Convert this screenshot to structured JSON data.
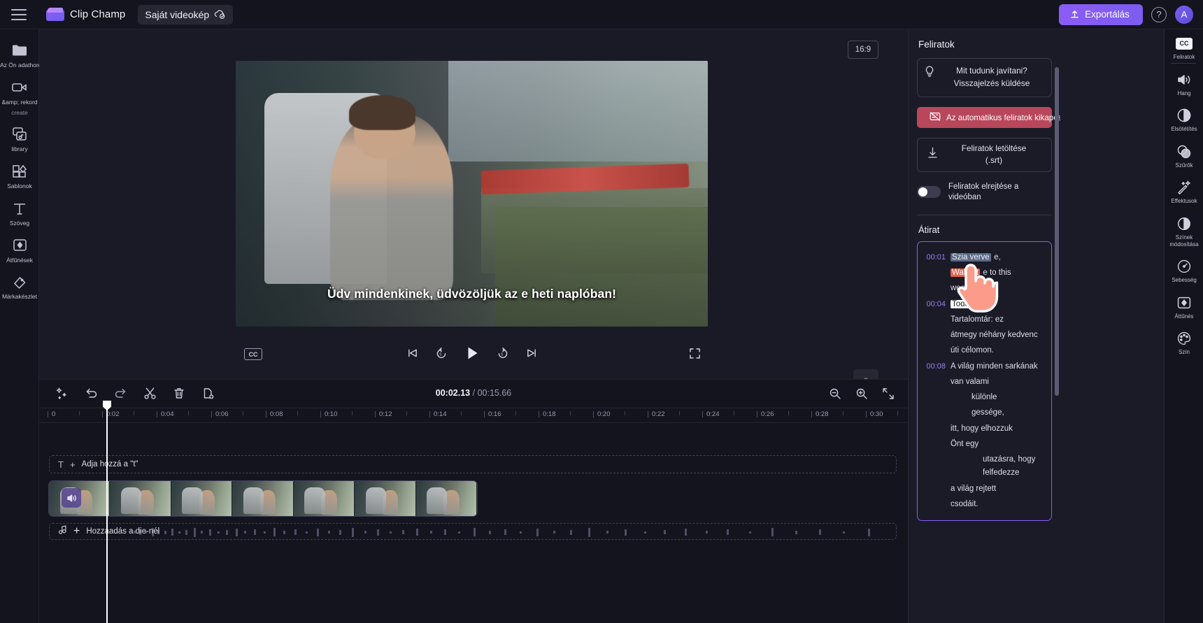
{
  "topbar": {
    "menu_icon": "hamburger-icon",
    "brand": "Clip Champ",
    "project_name": "Saját videokép",
    "project_sync_icon": "cloud-check-icon",
    "export_label": "Exportálás",
    "help_label": "?",
    "avatar_label": "A"
  },
  "left_rail": [
    {
      "icon": "folder-icon",
      "label": "Az Ön adathordozója",
      "sub": ""
    },
    {
      "icon": "video-camera-icon",
      "label": "&amp; rekord",
      "sub": "create"
    },
    {
      "icon": "library-icon",
      "label": "library",
      "sub": ""
    },
    {
      "icon": "templates-icon",
      "label": "Sablonok",
      "sub": ""
    },
    {
      "icon": "text-icon",
      "label": "Szöveg",
      "sub": ""
    },
    {
      "icon": "transitions-icon",
      "label": "Átfűnések",
      "sub": ""
    },
    {
      "icon": "brand-kit-icon",
      "label": "Márkakészlet",
      "sub": ""
    }
  ],
  "stage": {
    "aspect_ratio": "16:9",
    "caption_overlay": "Üdv mindenkinek, üdvözöljük az e heti naplóban!",
    "cc_button": "CC",
    "transport": [
      {
        "name": "skip-back-icon"
      },
      {
        "name": "rewind-5-icon"
      },
      {
        "name": "play-icon"
      },
      {
        "name": "forward-5-icon"
      },
      {
        "name": "skip-forward-icon"
      }
    ],
    "fullscreen_icon": "fullscreen-icon",
    "collapse_icon": "chevron-down-icon"
  },
  "timeline": {
    "tools": [
      {
        "name": "magic-wand-icon"
      },
      {
        "name": "undo-icon"
      },
      {
        "name": "redo-icon"
      },
      {
        "name": "split-scissors-icon"
      },
      {
        "name": "delete-trash-icon"
      },
      {
        "name": "duplicate-icon"
      }
    ],
    "current_time": "00:02.13",
    "separator": "/",
    "total_time": "00:15.66",
    "right_tools": [
      {
        "name": "zoom-out-icon"
      },
      {
        "name": "zoom-in-icon"
      },
      {
        "name": "fit-to-screen-icon"
      }
    ],
    "ruler_ticks": [
      "0",
      "0:02",
      "0:04",
      "0:06",
      "0:08",
      "0:10",
      "0:12",
      "0:14",
      "0:16",
      "0:18",
      "0:20",
      "0:22",
      "0:24",
      "0:26",
      "0:28",
      "0:30"
    ],
    "text_track_label": "Adja hozzá a \"t\"",
    "audio_track_label": "Hozzáadás a die-nél",
    "video_clip_audio_icon": "speaker-icon"
  },
  "captions_panel": {
    "title": "Feliratok",
    "feedback_line1": "Mit tudunk javítani?",
    "feedback_line2": "Visszajelzés küldése",
    "feedback_icon": "lightbulb-icon",
    "turn_off_label": "Az automatikus feliratok kikapcsolása",
    "turn_off_icon": "captions-off-icon",
    "turn_off_color": "#b8475b",
    "download_line1": "Feliratok letöltése",
    "download_line2": "(.srt)",
    "download_icon": "download-arrow-icon",
    "hide_toggle_label": "Feliratok elrejtése a videóban",
    "hide_toggle_state": "off",
    "transcript_title": "Átirat",
    "transcript_border_color": "#8b5cf6",
    "transcript": [
      {
        "time": "00:01",
        "segments": [
          {
            "text": "Szia verve",
            "style": "selected"
          },
          {
            "text": "e,",
            "style": "plain"
          }
        ],
        "indent": 0
      },
      {
        "time": "",
        "segments": [
          {
            "text": "Walcott",
            "style": "highlight"
          },
          {
            "text": "e to this",
            "style": "plain"
          }
        ],
        "indent": 0
      },
      {
        "time": "",
        "segments": [
          {
            "text": "week's",
            "style": "plain"
          }
        ],
        "indent": 0
      },
      {
        "time": "00:04",
        "segments": [
          {
            "text": "Todd",
            "style": "white"
          },
          {
            "text": ",",
            "style": "plain"
          }
        ],
        "indent": 0
      },
      {
        "time": "",
        "segments": [
          {
            "text": "Tartalomtár: ez",
            "style": "plain"
          }
        ],
        "indent": 0
      },
      {
        "time": "",
        "segments": [
          {
            "text": "átmegy néhány kedvenc",
            "style": "plain"
          }
        ],
        "indent": 0
      },
      {
        "time": "",
        "segments": [
          {
            "text": "úti célomon.",
            "style": "plain"
          }
        ],
        "indent": 0
      },
      {
        "time": "00:08",
        "segments": [
          {
            "text": "A világ minden sarkának",
            "style": "plain"
          }
        ],
        "indent": 0
      },
      {
        "time": "",
        "segments": [
          {
            "text": "van valami",
            "style": "plain"
          }
        ],
        "indent": 0
      },
      {
        "time": "",
        "segments": [
          {
            "text": "különle",
            "style": "plain"
          }
        ],
        "indent": 2
      },
      {
        "time": "",
        "segments": [
          {
            "text": "gessége,",
            "style": "plain"
          }
        ],
        "indent": 2
      },
      {
        "time": "",
        "segments": [
          {
            "text": "itt, hogy elhozzuk",
            "style": "plain"
          }
        ],
        "indent": 0
      },
      {
        "time": "",
        "segments": [
          {
            "text": "Önt egy",
            "style": "plain"
          }
        ],
        "indent": 0
      },
      {
        "time": "",
        "segments": [
          {
            "text": "utazásra, hogy felfedezze",
            "style": "plain"
          }
        ],
        "indent": 3
      },
      {
        "time": "",
        "segments": [
          {
            "text": "a világ rejtett",
            "style": "plain"
          }
        ],
        "indent": 0
      },
      {
        "time": "",
        "segments": [
          {
            "text": "csodáit.",
            "style": "plain"
          }
        ],
        "indent": 0
      }
    ],
    "cursor": "pointing-hand-cursor"
  },
  "right_rail": [
    {
      "icon": "cc-icon",
      "label": "Feliratok",
      "active": true
    },
    {
      "icon": "speaker-icon",
      "label": "Hang",
      "active": false
    },
    {
      "icon": "fade-icon",
      "label": "Elsötétítés",
      "active": false
    },
    {
      "icon": "filters-icon",
      "label": "Szűrők",
      "active": false
    },
    {
      "icon": "effects-sparkle-icon",
      "label": "Effektusok",
      "active": false
    },
    {
      "icon": "color-adjust-icon",
      "label": "Színek módosítása",
      "active": false
    },
    {
      "icon": "speed-gauge-icon",
      "label": "Sebesség",
      "active": false
    },
    {
      "icon": "transition-icon",
      "label": "Áttűnés",
      "active": false
    },
    {
      "icon": "palette-icon",
      "label": "Szín",
      "active": false
    }
  ]
}
